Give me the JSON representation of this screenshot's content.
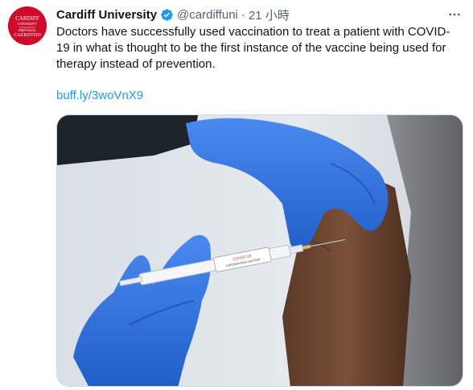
{
  "tweet": {
    "author": {
      "display_name": "Cardiff University",
      "handle": "@cardiffuni",
      "verified": true,
      "avatar_text": [
        "CARDIFF",
        "UNIVERSITY",
        "PRIFYSGOL",
        "CAERDYDD"
      ],
      "avatar_color": "#cf0a2c"
    },
    "separator": "·",
    "timestamp": "21 小時",
    "text": "Doctors have successfully used vaccination to treat a patient with COVID-19 in what is thought to be the first instance of the vaccine being used for therapy instead of prevention.",
    "link": "buff.ly/3woVnX9",
    "media": {
      "syringe_label": [
        "COVID-19",
        "CORONAVIRUS VACCINE"
      ]
    }
  },
  "colors": {
    "accent": "#1d9bf0",
    "text_primary": "#0f1419",
    "text_secondary": "#536471",
    "glove": "#2d6fd6"
  },
  "icons": {
    "verified": "verified-badge-icon",
    "more": "more-options-icon"
  }
}
